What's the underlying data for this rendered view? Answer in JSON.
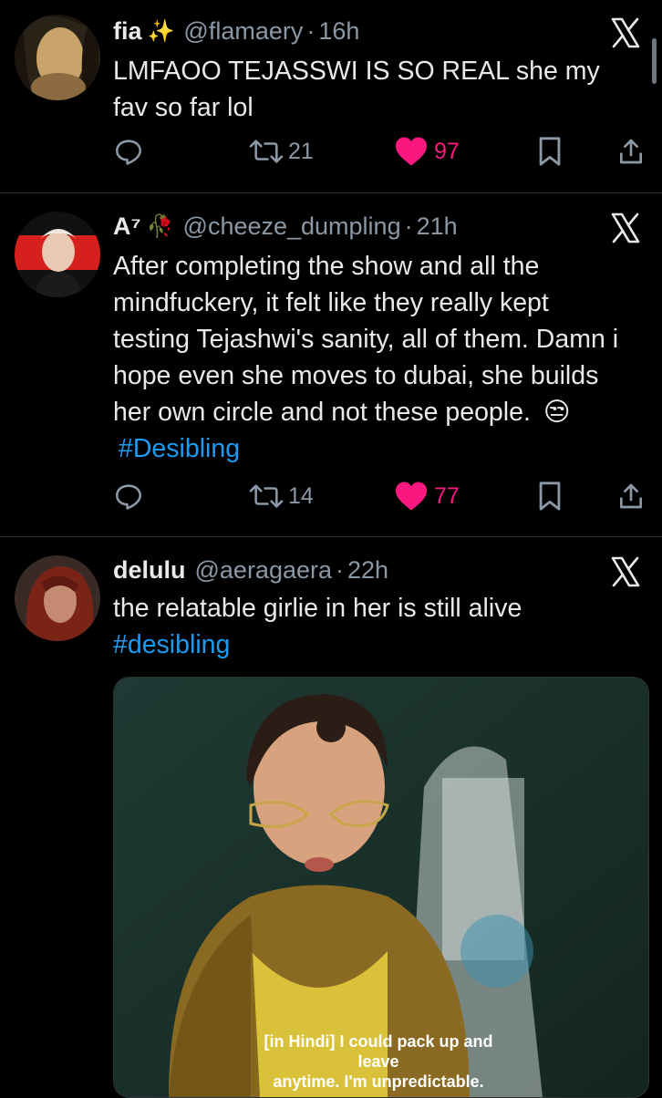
{
  "tweets": [
    {
      "name": "fia",
      "badge": "✨",
      "handle": "@flamaery",
      "separator": "·",
      "time": "16h",
      "text": "LMFAOO TEJASSWI IS SO REAL she my fav so far lol",
      "retweets": "21",
      "likes": "97"
    },
    {
      "name": "A⁷",
      "badge": "🥀",
      "handle": "@cheeze_dumpling",
      "separator": "·",
      "time": "21h",
      "text": "After completing the show and all the mindfuckery, it felt like they really kept testing Tejashwi's sanity, all of them. Damn i hope even she moves to dubai, she builds her own circle and not these people.",
      "emoji": "😒",
      "hashtag": "#Desibling",
      "retweets": "14",
      "likes": "77"
    },
    {
      "name": "delulu",
      "handle": "@aeragaera",
      "separator": "·",
      "time": "22h",
      "text": "the relatable girlie in her is still alive",
      "hashtag": "#desibling",
      "media_caption_line1": "[in Hindi] I could pack up and leave",
      "media_caption_line2": "anytime. I'm unpredictable."
    }
  ],
  "colors": {
    "background": "#000000",
    "text": "#e7e9ea",
    "muted": "#8b98a5",
    "hashtag": "#1d9bf0",
    "like": "#f91880"
  }
}
